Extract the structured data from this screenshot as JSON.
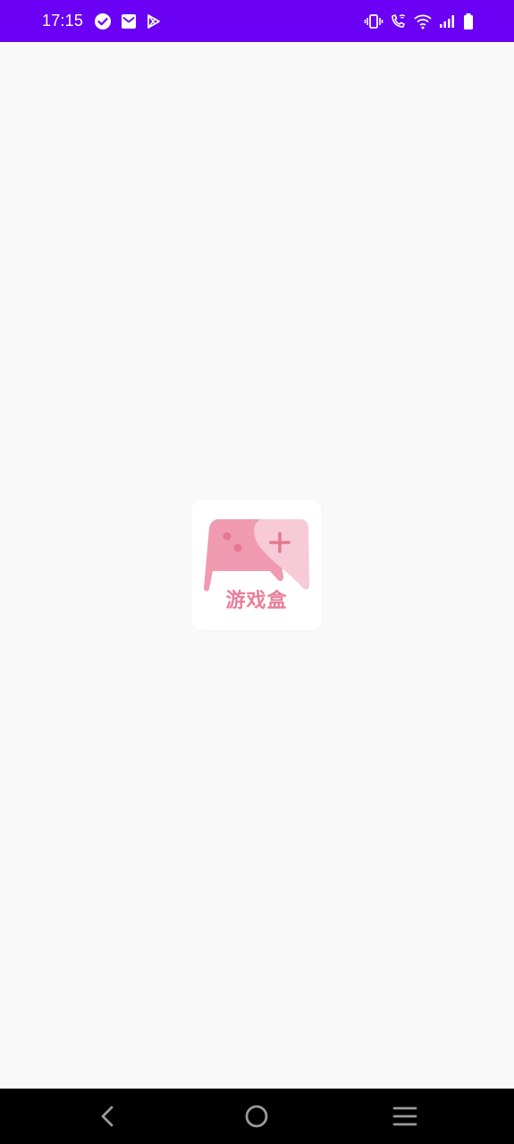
{
  "status_bar": {
    "time": "17:15",
    "left_icons": [
      "check-circle-icon",
      "mail-icon",
      "play-store-icon"
    ],
    "right_icons": [
      "vibrate-icon",
      "wifi-call-icon",
      "wifi-icon",
      "signal-icon",
      "battery-icon"
    ],
    "background_color": "#6a00f4"
  },
  "splash": {
    "logo_text": "游戏盒",
    "logo_icon": "gamepad-icon",
    "accent_color": "#ea7d9b"
  },
  "nav_bar": {
    "buttons": [
      "back",
      "home",
      "recents"
    ]
  }
}
